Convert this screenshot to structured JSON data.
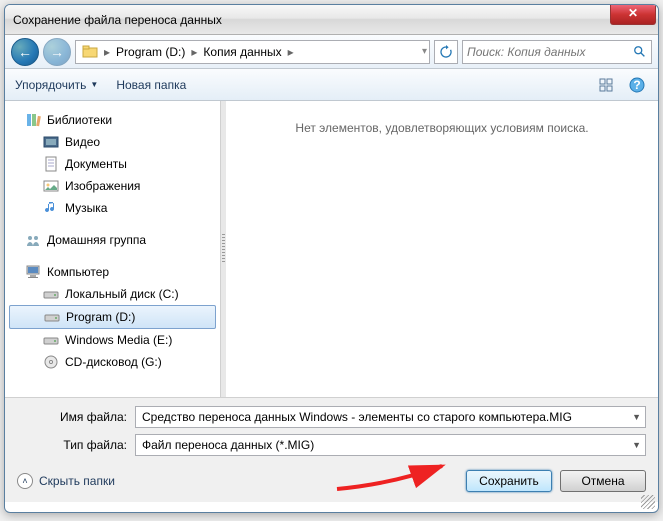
{
  "title": "Сохранение файла переноса данных",
  "breadcrumb": {
    "drive": "Program (D:)",
    "folder": "Копия данных"
  },
  "search": {
    "placeholder": "Поиск: Копия данных"
  },
  "toolbar": {
    "organize": "Упорядочить",
    "newfolder": "Новая папка"
  },
  "sidebar": {
    "libraries": {
      "label": "Библиотеки",
      "video": "Видео",
      "docs": "Документы",
      "images": "Изображения",
      "music": "Музыка"
    },
    "homegroup": "Домашняя группа",
    "computer": {
      "label": "Компьютер",
      "c": "Локальный диск (C:)",
      "d": "Program (D:)",
      "e": "Windows Media  (E:)",
      "g": "CD-дисковод (G:)"
    }
  },
  "main": {
    "empty": "Нет элементов, удовлетворяющих условиям поиска."
  },
  "fields": {
    "name_label": "Имя файла:",
    "name_value": "Средство переноса данных Windows - элементы со старого компьютера.MIG",
    "type_label": "Тип файла:",
    "type_value": "Файл переноса данных (*.MIG)"
  },
  "buttons": {
    "save": "Сохранить",
    "cancel": "Отмена",
    "hide": "Скрыть папки"
  }
}
